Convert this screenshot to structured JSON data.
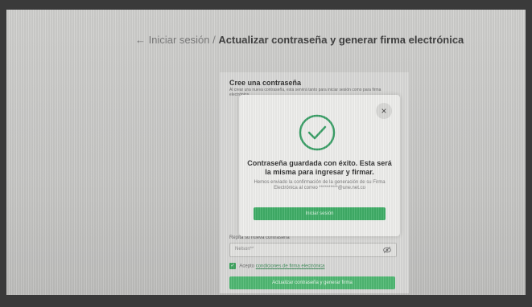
{
  "breadcrumb": {
    "back_arrow": "←",
    "previous": "Iniciar sesión",
    "separator": "/",
    "current": "Actualizar contraseña y generar firma electrónica"
  },
  "form": {
    "title": "Cree una contraseña",
    "subtitle": "Al crear una nueva contraseña, esta servirá tanto para iniciar sesión como para firma electrónica.",
    "repeat_label": "Repita su nueva contraseña",
    "repeat_value": "Nelson**",
    "terms_prefix": "Acepto",
    "terms_link": "condiciones de firma electrónica",
    "submit_label": "Actualizar contraseña y generar firma"
  },
  "modal": {
    "close_glyph": "×",
    "title": "Contraseña guardada con éxito. Esta será la misma para ingresar y firmar.",
    "body": "Hemos enviado la confirmación de la generación de su Firma Electrónica al correo **********@une.net.co",
    "login_button": "Iniciar sesión"
  },
  "colors": {
    "accent_green": "#3fae67",
    "check_green": "#3a9f67"
  }
}
